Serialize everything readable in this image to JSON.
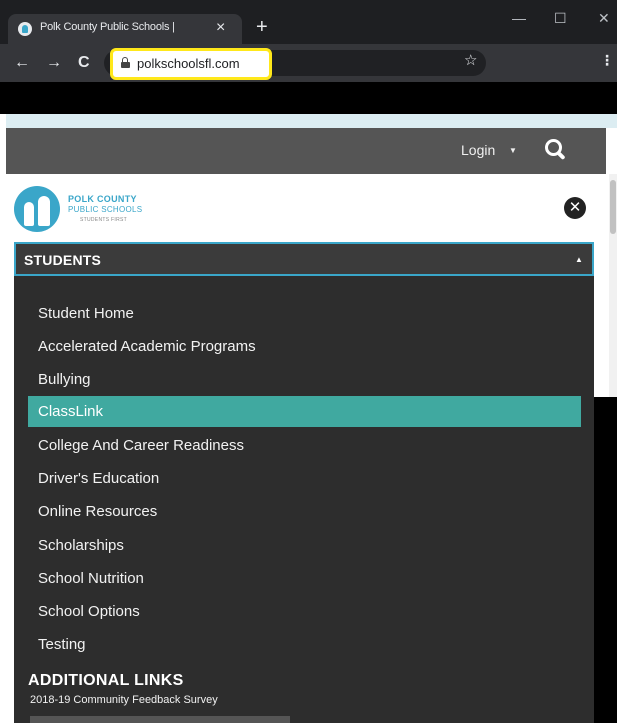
{
  "browser": {
    "tab_title": "Polk County Public Schools |",
    "tab_close": "×",
    "new_tab": "+",
    "win_min": "—",
    "win_max": "☐",
    "win_close": "✕",
    "nav_back": "←",
    "nav_forward": "→",
    "nav_reload": "C",
    "url": "polkschoolsfl.com",
    "star": "☆",
    "menu": "⋮",
    "highlight_color": "#ffe81a"
  },
  "site": {
    "login_label": "Login",
    "login_caret": "▼",
    "logo_line1": "POLK COUNTY",
    "logo_line2": "PUBLIC SCHOOLS",
    "logo_line3": "STUDENTS FIRST",
    "close_glyph": "✕",
    "accent_color": "#3aa6c9",
    "active_color": "#40a9a0"
  },
  "dropdown": {
    "label": "STUDENTS",
    "caret": "▲"
  },
  "menu_items": [
    {
      "label": "Student Home"
    },
    {
      "label": "Accelerated Academic Programs"
    },
    {
      "label": "Bullying"
    },
    {
      "label": "ClassLink",
      "active": true
    },
    {
      "label": "College And Career Readiness"
    },
    {
      "label": "Driver's Education"
    },
    {
      "label": "Online Resources"
    },
    {
      "label": "Scholarships"
    },
    {
      "label": "School Nutrition"
    },
    {
      "label": "School Options"
    },
    {
      "label": "Testing"
    }
  ],
  "additional_links": {
    "heading": "ADDITIONAL LINKS",
    "items": [
      "2018-19 Community Feedback Survey"
    ]
  }
}
